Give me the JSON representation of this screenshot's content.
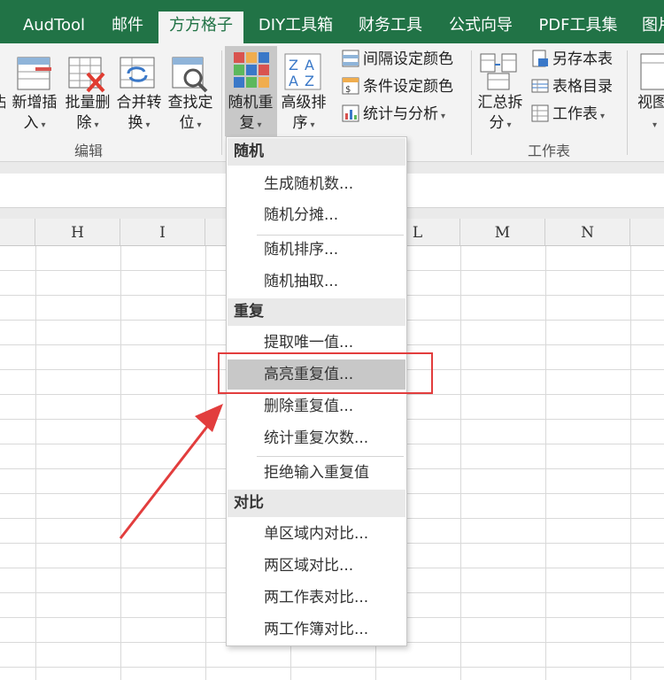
{
  "tabs": [
    {
      "label": "AudTool"
    },
    {
      "label": "邮件"
    },
    {
      "label": "方方格子",
      "active": true
    },
    {
      "label": "DIY工具箱"
    },
    {
      "label": "财务工具"
    },
    {
      "label": "公式向导"
    },
    {
      "label": "PDF工具集"
    },
    {
      "label": "图片"
    }
  ],
  "ribbon": {
    "edit_group": {
      "label": "编辑",
      "partial_label_1": "占",
      "buttons": [
        {
          "line1": "新增插",
          "line2": "入"
        },
        {
          "line1": "批量删",
          "line2": "除"
        },
        {
          "line1": "合并转",
          "line2": "换"
        },
        {
          "line1": "查找定",
          "line2": "位"
        }
      ]
    },
    "random_dup": {
      "line1": "随机重",
      "line2": "复"
    },
    "advanced_sort": {
      "line1": "高级排",
      "line2": "序"
    },
    "small_buttons": [
      {
        "label": "间隔设定颜色"
      },
      {
        "label": "条件设定颜色"
      },
      {
        "label": "统计与分析"
      }
    ],
    "worksheet_group": {
      "label": "工作表",
      "summary_split": {
        "line1": "汇总拆",
        "line2": "分"
      },
      "small_buttons": [
        {
          "label": "另存本表"
        },
        {
          "label": "表格目录"
        },
        {
          "label": "工作表"
        }
      ]
    },
    "view": {
      "line1": "视图"
    }
  },
  "columns": [
    "H",
    "I",
    "",
    "",
    "L",
    "M",
    "N"
  ],
  "menu": {
    "sections": [
      {
        "header": "随机",
        "items": [
          "生成随机数...",
          "随机分摊...",
          "随机排序...",
          "随机抽取..."
        ]
      },
      {
        "header": "重复",
        "items": [
          "提取唯一值...",
          "高亮重复值...",
          "删除重复值...",
          "统计重复次数...",
          "拒绝输入重复值"
        ]
      },
      {
        "header": "对比",
        "items": [
          "单区域内对比...",
          "两区域对比...",
          "两工作表对比...",
          "两工作簿对比..."
        ]
      }
    ],
    "highlighted": "高亮重复值..."
  },
  "colors": {
    "accent": "#217346",
    "highlight_box": "#e23d3d",
    "arrow": "#e23d3d"
  }
}
